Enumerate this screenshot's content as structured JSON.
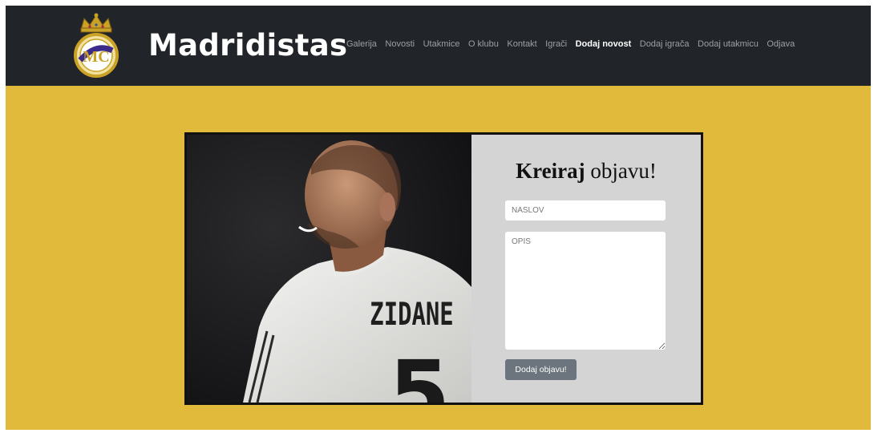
{
  "header": {
    "brand": "Madridistas",
    "nav": [
      {
        "label": "Galerija",
        "active": false
      },
      {
        "label": "Novosti",
        "active": false
      },
      {
        "label": "Utakmice",
        "active": false
      },
      {
        "label": "O klubu",
        "active": false
      },
      {
        "label": "Kontakt",
        "active": false
      },
      {
        "label": "Igrači",
        "active": false
      },
      {
        "label": "Dodaj novost",
        "active": true
      },
      {
        "label": "Dodaj igrača",
        "active": false
      },
      {
        "label": "Dodaj utakmicu",
        "active": false
      },
      {
        "label": "Odjava",
        "active": false
      }
    ]
  },
  "photo": {
    "jersey_name": "ZIDANE",
    "jersey_number": "5"
  },
  "form": {
    "title_bold": "Kreiraj",
    "title_rest": " objavu!",
    "title_placeholder": "NASLOV",
    "title_value": "",
    "description_placeholder": "OPIS",
    "description_value": "",
    "submit_label": "Dodaj objavu!"
  },
  "colors": {
    "background": "#e1ba3b",
    "navbar": "#212529",
    "form_panel": "#d4d4d4",
    "button": "#6c757d"
  }
}
